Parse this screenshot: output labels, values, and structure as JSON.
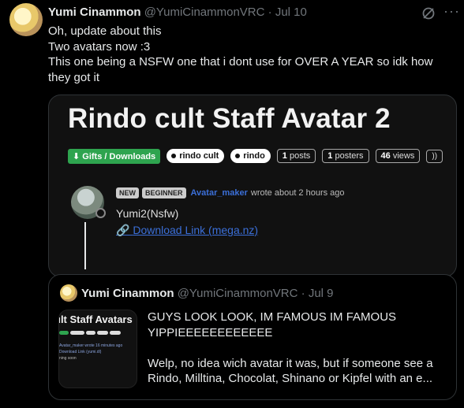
{
  "tweet": {
    "author_name": "Yumi Cinammon",
    "handle": "@YumiCinammonVRC",
    "separator": "·",
    "date": "Jul 10",
    "lines": [
      "Oh, update about this",
      "Two avatars now :3",
      "This one being a NSFW one that i dont use for OVER A YEAR so idk how they got it"
    ]
  },
  "card": {
    "title": "Rindo cult Staff Avatar 2",
    "category": "Gifts / Downloads",
    "tags": [
      "rindo cult",
      "rindo"
    ],
    "stats": [
      {
        "num": "1",
        "label": "posts"
      },
      {
        "num": "1",
        "label": "posters"
      },
      {
        "num": "46",
        "label": "views"
      }
    ],
    "rss_icon": "rss-icon",
    "post": {
      "badges": [
        "NEW",
        "BEGINNER"
      ],
      "username": "Avatar_maker",
      "wrote": "wrote about 2 hours ago",
      "body": "Yumi2(Nsfw)",
      "link_icon": "🔗",
      "link_text": "Download Link (mega.nz)"
    }
  },
  "quote": {
    "author_name": "Yumi Cinammon",
    "handle": "@YumiCinammonVRC",
    "separator": "·",
    "date": "Jul 9",
    "thumb": {
      "title": "ult Staff Avatars",
      "line1": "Avatar_maker wrote 16 minutes ago",
      "line2": "Download Link (yumi.dl)",
      "line3": "ning soon"
    },
    "line1": "GUYS LOOK LOOK, IM FAMOUS IM FAMOUS",
    "line2": "YIPPIEEEEEEEEEEEE",
    "line3": "Welp, no idea wich avatar it was, but if someone see a",
    "line4": "Rindo, Milltina, Chocolat, Shinano or Kipfel with an e..."
  },
  "icons": {
    "grok": "⊘",
    "more": "···"
  }
}
